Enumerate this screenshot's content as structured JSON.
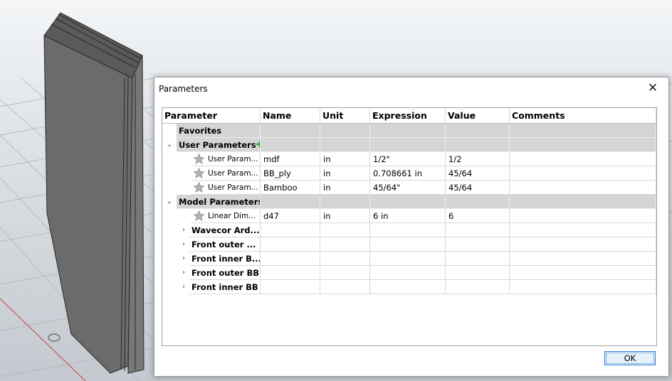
{
  "dialog": {
    "title": "Parameters",
    "close_glyph": "✕",
    "ok_label": "OK"
  },
  "columns": [
    "Parameter",
    "Name",
    "Unit",
    "Expression",
    "Value",
    "Comments"
  ],
  "groups": {
    "favorites": "Favorites",
    "user": "User Parameters",
    "user_add_glyph": "✚",
    "model": "Model Parameters"
  },
  "user_params": [
    {
      "parameter": "User Param...",
      "name": "mdf",
      "unit": "in",
      "expression": "1/2\"",
      "value": "1/2",
      "comments": ""
    },
    {
      "parameter": "User Param...",
      "name": "BB_ply",
      "unit": "in",
      "expression": "0.708661 in",
      "value": "45/64",
      "comments": ""
    },
    {
      "parameter": "User Param...",
      "name": "Bamboo",
      "unit": "in",
      "expression": "45/64\"",
      "value": "45/64",
      "comments": ""
    }
  ],
  "model_params": [
    {
      "parameter": "Linear Dim...",
      "name": "d47",
      "unit": "in",
      "expression": "6 in",
      "value": "6",
      "comments": ""
    }
  ],
  "components": [
    "Wavecor Ard...",
    "Front outer ...",
    "Front inner B...",
    "Front outer BB",
    "Front inner BB"
  ],
  "icons": {
    "expand": "chevron-down-icon",
    "collapse": "chevron-right-icon",
    "favorite": "star-icon"
  },
  "colors": {
    "group_row": "#d5d5d5",
    "ok_border": "#2c7bd1",
    "plus": "#1a9a2a"
  }
}
